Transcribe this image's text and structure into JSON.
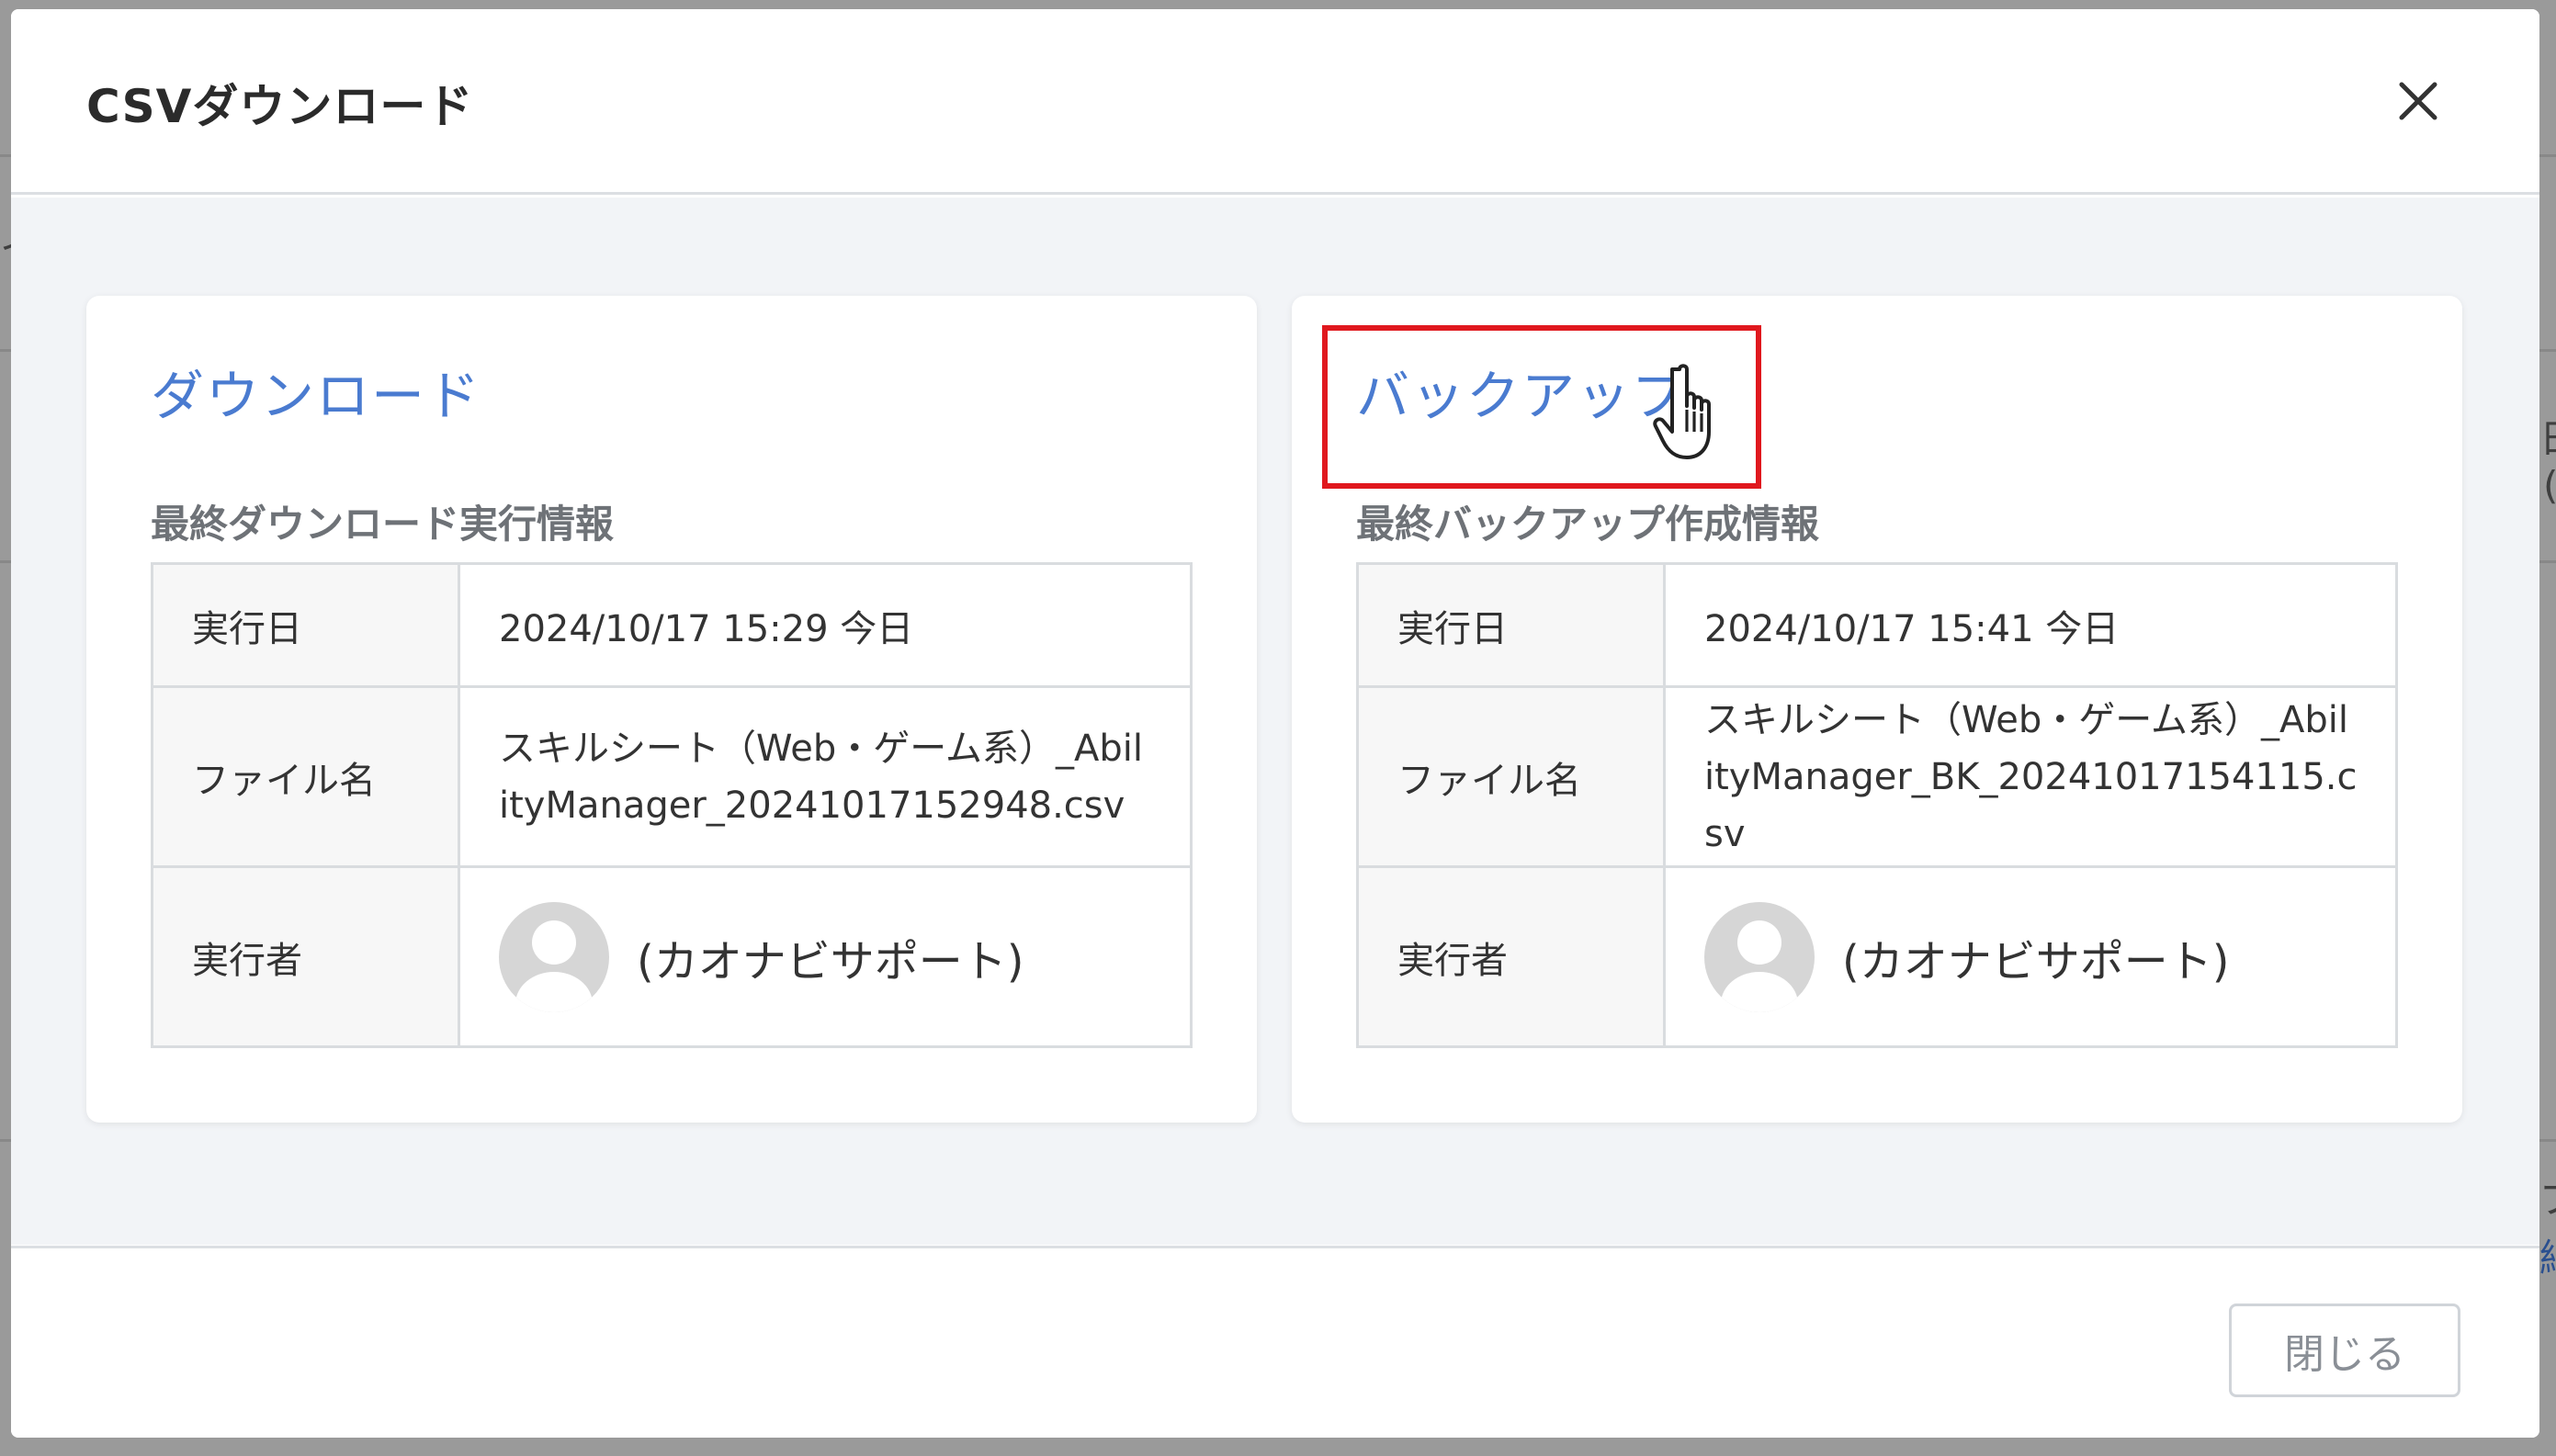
{
  "background": {
    "fragments": [
      "イ",
      "日",
      "(",
      "ブ",
      "細"
    ]
  },
  "modal": {
    "title": "CSVダウンロード",
    "close_icon": "close-icon",
    "footer": {
      "close_label": "閉じる"
    }
  },
  "download_card": {
    "link_label": "ダウンロード",
    "subtitle": "最終ダウンロード実行情報",
    "rows": {
      "date_label": "実行日",
      "date_value": "2024/10/17 15:29 今日",
      "file_label": "ファイル名",
      "file_value": "スキルシート（Web・ゲーム系）_AbilityManager_20241017152948.csv",
      "user_label": "実行者",
      "user_value": "(カオナビサポート)"
    }
  },
  "backup_card": {
    "link_label": "バックアップ",
    "subtitle": "最終バックアップ作成情報",
    "rows": {
      "date_label": "実行日",
      "date_value": "2024/10/17 15:41 今日",
      "file_label": "ファイル名",
      "file_value": "スキルシート（Web・ゲーム系）_AbilityManager_BK_20241017154115.csv",
      "user_label": "実行者",
      "user_value": "(カオナビサポート)"
    }
  },
  "colors": {
    "link": "#4a7bd0",
    "highlight": "#e0181e"
  },
  "icons": {
    "avatar": "user-avatar-icon",
    "cursor": "hand-pointer-icon"
  }
}
